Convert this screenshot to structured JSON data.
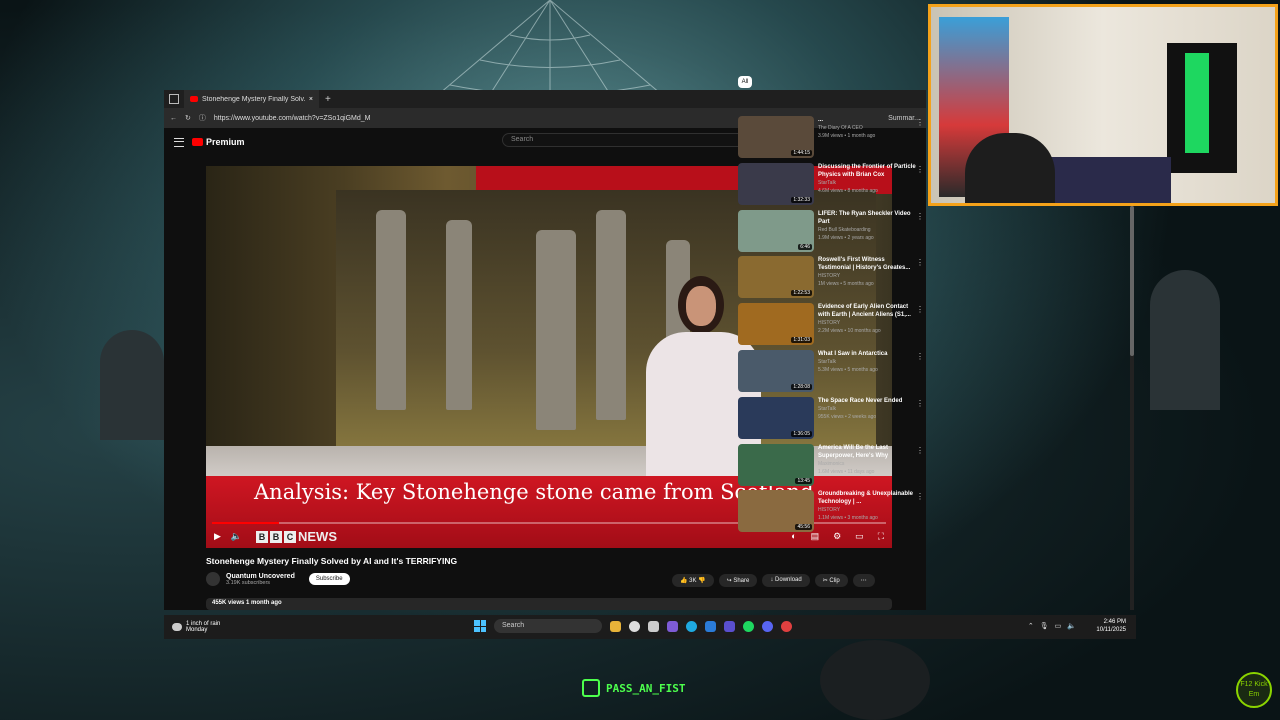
{
  "browser": {
    "tab_title": "Stonehenge Mystery Finally Solv...",
    "tab_close": "×",
    "new_tab": "+",
    "url": "https://www.youtube.com/watch?v=ZSo1qiGMd_M",
    "right_label": "Summar..."
  },
  "youtube": {
    "logo_text": "Premium",
    "search_placeholder": "Search",
    "player": {
      "lower_third": "Analysis: Key Stonehenge stone came from Scotland",
      "news_logo": "NEWS",
      "progress": 0.1
    },
    "video": {
      "title": "Stonehenge Mystery Finally Solved by AI and It's TERRIFYING",
      "channel": "Quantum Uncovered",
      "subscribers": "3.19K subscribers",
      "subscribe_label": "Subscribe",
      "likes": "3K",
      "share_label": "Share",
      "download_label": "Download",
      "clip_label": "Clip",
      "views_line": "455K views  1 month ago"
    },
    "sidebar": {
      "chip": "All",
      "items": [
        {
          "title": "...",
          "channel": "The Diary Of A CEO",
          "meta": "3.9M views • 1 month ago",
          "duration": "1:44:15",
          "color": "#5a4a3a"
        },
        {
          "title": "Discussing the Frontier of Particle Physics with Brian Cox",
          "channel": "StarTalk",
          "meta": "4.6M views • 8 months ago",
          "duration": "1:32:33",
          "color": "#3a3a4a"
        },
        {
          "title": "LIFER: The Ryan Sheckler Video Part",
          "channel": "Red Bull Skateboarding",
          "meta": "1.9M views • 2 years ago",
          "duration": "6:46",
          "color": "#7f9a8a"
        },
        {
          "title": "Roswell's First Witness Testimonial | History's Greates...",
          "channel": "HISTORY",
          "meta": "1M views • 5 months ago",
          "duration": "1:22:53",
          "color": "#8a6a30"
        },
        {
          "title": "Evidence of Early Alien Contact with Earth | Ancient Aliens (S1,...",
          "channel": "HISTORY",
          "meta": "2.2M views • 10 months ago",
          "duration": "1:31:03",
          "color": "#a06a20"
        },
        {
          "title": "What I Saw in Antarctica",
          "channel": "StarTalk",
          "meta": "5.3M views • 5 months ago",
          "duration": "1:28:08",
          "color": "#4a5a6a"
        },
        {
          "title": "The Space Race Never Ended",
          "channel": "StarTalk",
          "meta": "955K views • 2 weeks ago",
          "duration": "1:36:05",
          "color": "#2a3a5a"
        },
        {
          "title": "America Will Be the Last Superpower, Here's Why",
          "channel": "Maximonics",
          "meta": "1.6M views • 11 days ago",
          "duration": "13:45",
          "color": "#3a6a4a"
        },
        {
          "title": "Groundbreaking & Unexplainable Technology | ...",
          "channel": "HISTORY",
          "meta": "1.1M views • 3 months ago",
          "duration": "45:56",
          "color": "#8a6a40"
        }
      ]
    }
  },
  "taskbar": {
    "weather_text": "1 inch of rain",
    "weather_sub": "Monday",
    "search_label": "Search",
    "time": "2:46 PM",
    "date": "10/11/2025"
  },
  "overlay": {
    "tag": "PASS_AN_FIST",
    "badge": "F12 Kick Em"
  }
}
